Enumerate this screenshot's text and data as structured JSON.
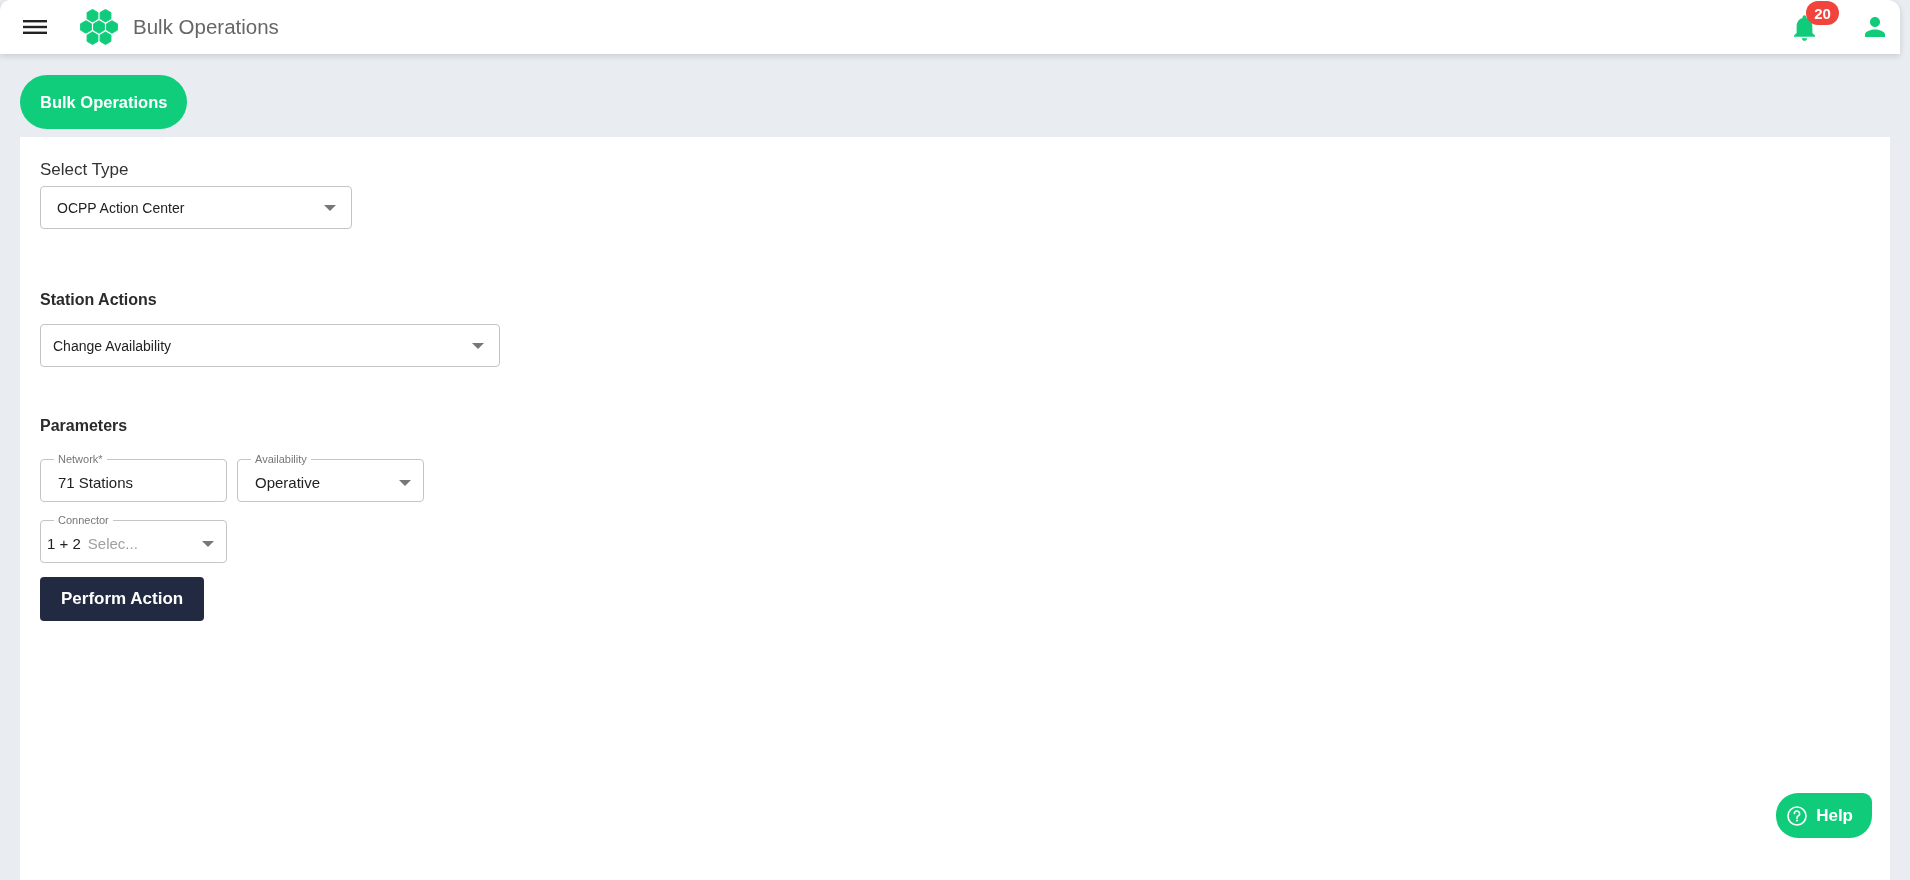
{
  "header": {
    "title": "Bulk Operations",
    "notification_count": "20"
  },
  "tabs": [
    {
      "label": "Bulk Operations",
      "selected": true
    }
  ],
  "form": {
    "select_type": {
      "label": "Select Type",
      "value": "OCPP Action Center"
    },
    "station_actions": {
      "heading": "Station Actions",
      "value": "Change Availability"
    },
    "parameters": {
      "heading": "Parameters",
      "fields": [
        {
          "kind": "text",
          "label": "Network*",
          "value": "71 Stations"
        },
        {
          "kind": "select",
          "label": "Availability",
          "value": "Operative"
        },
        {
          "kind": "multiselect",
          "label": "Connector",
          "value": "1 + 2",
          "placeholder": "Selec..."
        }
      ]
    },
    "submit": {
      "label": "Perform Action"
    }
  },
  "help_button": {
    "label": "Help"
  }
}
